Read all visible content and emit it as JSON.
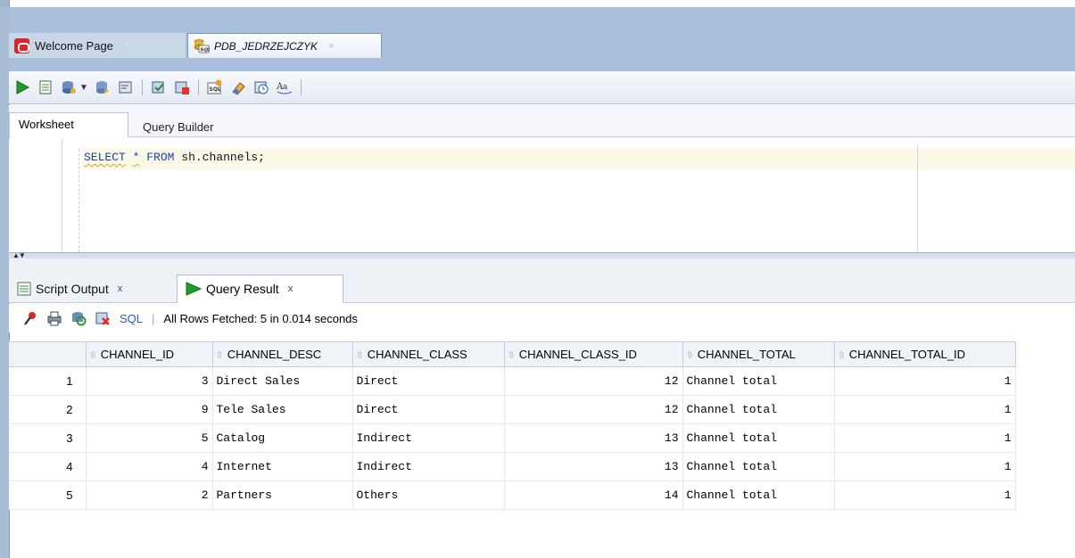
{
  "doc_tabs": [
    {
      "label": "Welcome Page",
      "icon": "oracle-logo-icon"
    },
    {
      "label": "PDB_JEDRZEJCZYK",
      "icon": "sql-database-icon"
    }
  ],
  "tab_close_glyph": "×",
  "worksheet_tabs": [
    "Worksheet",
    "Query Builder"
  ],
  "editor": {
    "keyword_select": "SELECT",
    "star": "*",
    "keyword_from": "FROM",
    "rest": "sh.channels;"
  },
  "output_tabs": [
    {
      "label": "Script Output",
      "close": "x"
    },
    {
      "label": "Query Result",
      "close": "x"
    }
  ],
  "result_toolbar": {
    "sql_label": "SQL",
    "separator": "|",
    "status": "All Rows Fetched: 5 in 0.014 seconds"
  },
  "grid": {
    "columns": [
      "CHANNEL_ID",
      "CHANNEL_DESC",
      "CHANNEL_CLASS",
      "CHANNEL_CLASS_ID",
      "CHANNEL_TOTAL",
      "CHANNEL_TOTAL_ID"
    ],
    "rows": [
      {
        "n": "1",
        "cells": [
          "3",
          "Direct Sales",
          "Direct",
          "12",
          "Channel total",
          "1"
        ]
      },
      {
        "n": "2",
        "cells": [
          "9",
          "Tele Sales",
          "Direct",
          "12",
          "Channel total",
          "1"
        ]
      },
      {
        "n": "3",
        "cells": [
          "5",
          "Catalog",
          "Indirect",
          "13",
          "Channel total",
          "1"
        ]
      },
      {
        "n": "4",
        "cells": [
          "4",
          "Internet",
          "Indirect",
          "13",
          "Channel total",
          "1"
        ]
      },
      {
        "n": "5",
        "cells": [
          "2",
          "Partners",
          "Others",
          "14",
          "Channel total",
          "1"
        ]
      }
    ]
  },
  "colors": {
    "keyword": "#1a3fb0",
    "current_line": "#fdf9e8",
    "oracle_red": "#d8242a",
    "run_green": "#1e9e2e"
  }
}
